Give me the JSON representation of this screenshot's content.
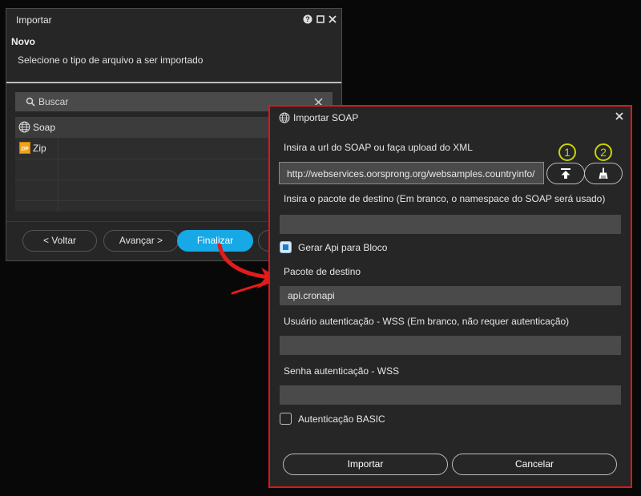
{
  "import_dialog": {
    "title": "Importar",
    "section_title": "Novo",
    "description": "Selecione o tipo de arquivo a ser importado",
    "search_placeholder": "Buscar",
    "items": [
      {
        "label": "Soap",
        "icon": "globe-icon",
        "selected": true
      },
      {
        "label": "Zip",
        "icon": "zip-file-icon",
        "selected": false
      }
    ],
    "buttons": {
      "back": "< Voltar",
      "next": "Avançar >",
      "finish": "Finalizar"
    },
    "accent_color": "#17a8e6"
  },
  "soap_dialog": {
    "title": "Importar SOAP",
    "url_label": "Insira a url do SOAP ou faça upload do XML",
    "url_value": "http://webservices.oorsprong.org/websamples.countryinfo/",
    "upload_icon": "upload-icon",
    "clear_icon": "broom-icon",
    "markers": [
      "1",
      "2"
    ],
    "package_label": "Insira o pacote de destino (Em branco, o namespace do SOAP será usado)",
    "package_value": "",
    "generate_api_label": "Gerar Api para Bloco",
    "generate_api_checked": true,
    "dest_package_label": "Pacote de destino",
    "dest_package_value": "api.cronapi",
    "wss_user_label": "Usuário autenticação - WSS (Em branco, não requer autenticação)",
    "wss_user_value": "",
    "wss_password_label": "Senha autenticação - WSS",
    "wss_password_value": "",
    "basic_auth_label": "Autenticação BASIC",
    "basic_auth_checked": false,
    "import_button": "Importar",
    "cancel_button": "Cancelar",
    "highlight_color": "#e0151c",
    "marker_color": "#c8d400"
  }
}
